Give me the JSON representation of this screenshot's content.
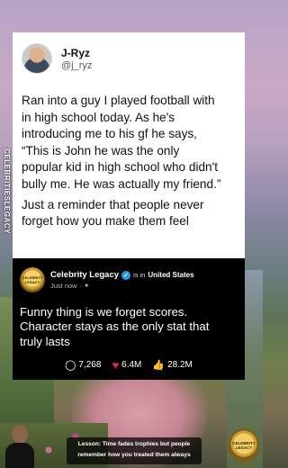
{
  "watermark": {
    "side_text": "CELEBRITIESLEGACY"
  },
  "tweet": {
    "author_name": "J-Ryz",
    "author_handle": "@j_ryz",
    "body_lines": [
      "Ran into a guy I played football with",
      "in high school today. As he's",
      "introducing me to his gf he says,",
      "“This is John he was the only",
      "popular kid in high school who didn't",
      "bully me. He was actually my friend.”"
    ],
    "closing_lines": [
      "Just a reminder that people never",
      "forget how you make them feel"
    ]
  },
  "post": {
    "logo_text": "CELEBRITY LEGACY",
    "account_name": "Celebrity Legacy",
    "verified_icon": "verified-check-icon",
    "is_in_text": "is in",
    "location": "United States",
    "timestamp": "Just now",
    "privacy_icon": "globe-icon",
    "body_lines": [
      "Funny thing is we forget scores.",
      "Character stays as the only stat that",
      "truly lasts"
    ],
    "stats": {
      "comments": "7,268",
      "likes": "6.4M",
      "thumbs": "28.2M"
    },
    "colors": {
      "heart": "#e0245e",
      "verified": "#1d9bf0"
    }
  },
  "caption": {
    "line1": "Lesson: Time fades trophies but people",
    "line2": "remember how you treated them always"
  },
  "badge": {
    "text": "CELEBRITY LEGACY"
  }
}
